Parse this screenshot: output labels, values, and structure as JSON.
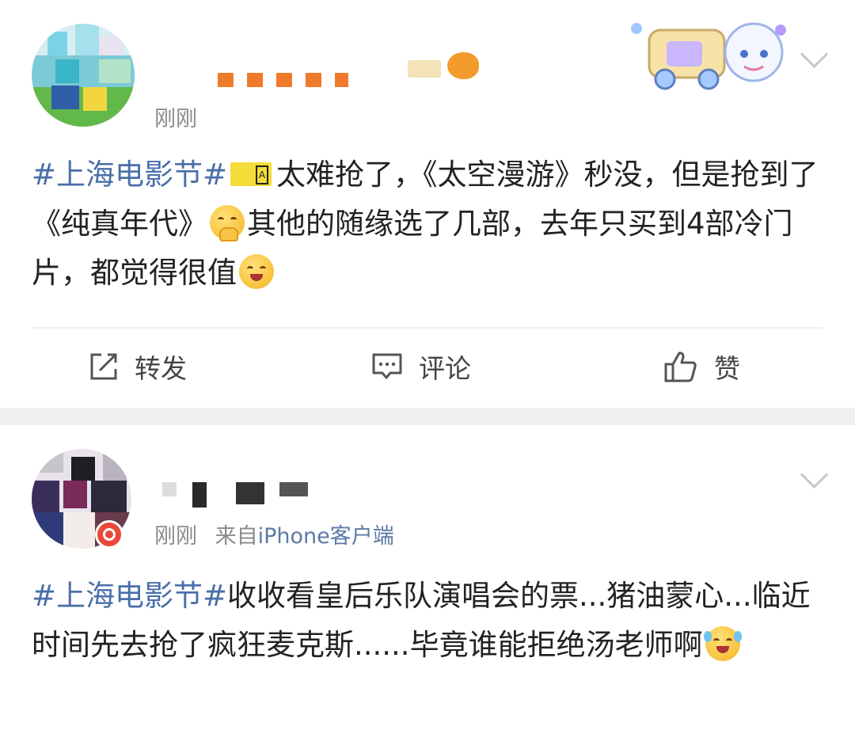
{
  "post1": {
    "time": "刚刚",
    "topic": "#上海电影节#",
    "ticket_emoji": {
      "icon": "concert-ticket-icon",
      "stub": "A"
    },
    "text_a": "太难抢了，《太空漫游》秒没，但是抢到了《纯真年代》",
    "text_b": "其他的随缘选了几部，去年只买到4部冷门片，都觉得很值",
    "emoji_1": "shy-hug-face-icon",
    "emoji_2": "smiling-face-icon"
  },
  "actions": {
    "repost": "转发",
    "comment": "评论",
    "like": "赞"
  },
  "post2": {
    "time": "刚刚",
    "source_prefix": "来自",
    "source_app": "iPhone客户端",
    "topic": "#上海电影节#",
    "text": "收收看皇后乐队演唱会的票...猪油蒙心...临近时间先去抢了疯狂麦克斯......毕竟谁能拒绝汤老师啊",
    "emoji": "laughing-crying-face-icon"
  },
  "colors": {
    "topic": "#4a6ea9",
    "meta": "#8a8a8a",
    "separator": "#efefef"
  }
}
